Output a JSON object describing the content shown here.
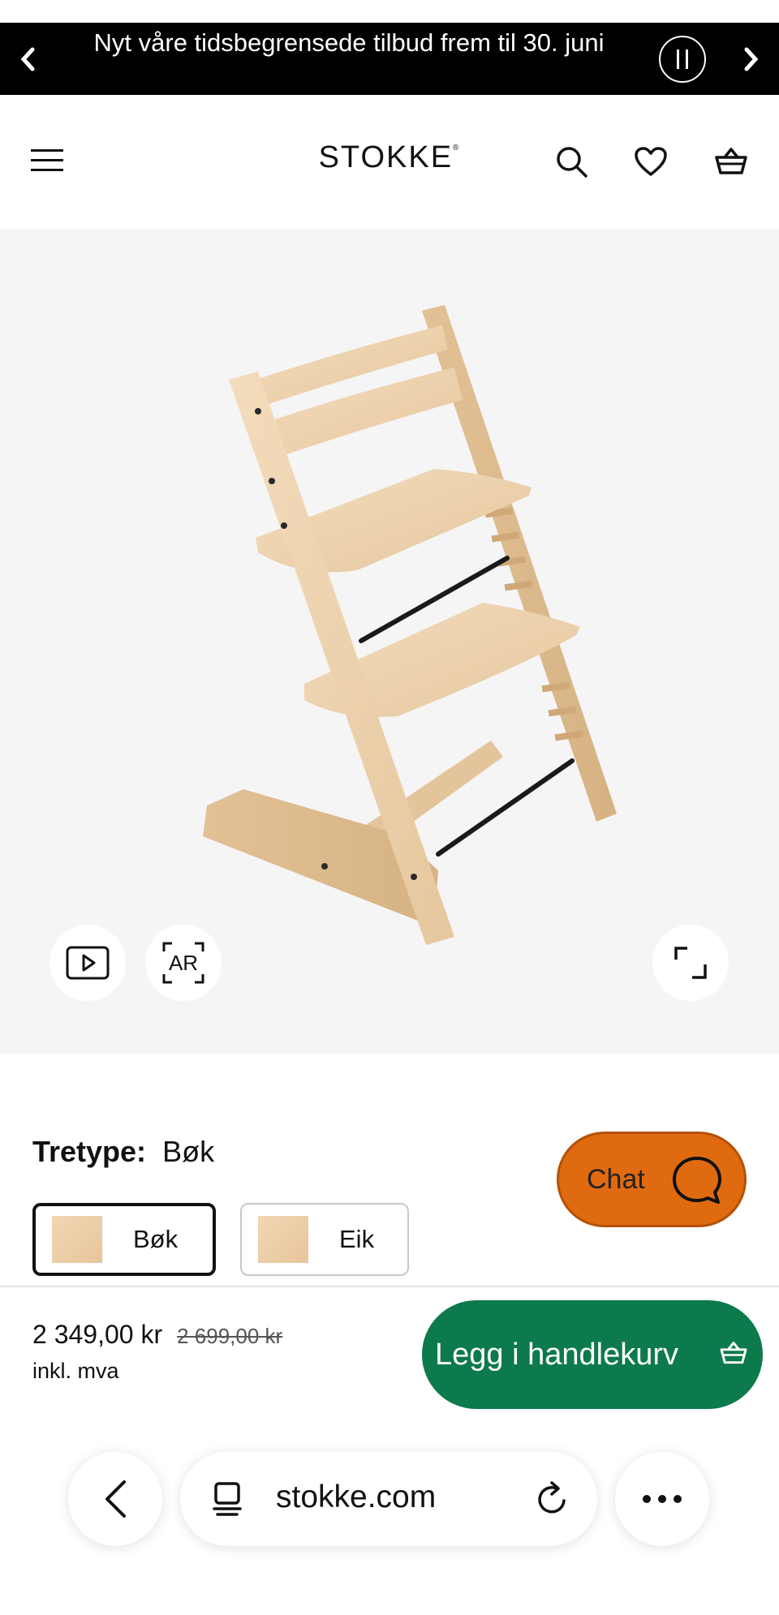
{
  "promo": {
    "prev_icon": "chevron-left-icon",
    "text": "Nyt våre tidsbegrensede tilbud frem til 30. juni",
    "pause_icon": "pause-icon",
    "next_icon": "chevron-right-icon"
  },
  "header": {
    "logo": "STOKKE",
    "logo_mark": "®",
    "icons": [
      "menu-icon",
      "search-icon",
      "heart-icon",
      "basket-icon"
    ]
  },
  "gallery": {
    "video_icon": "play-icon",
    "ar_label": "AR",
    "fullscreen_icon": "expand-icon"
  },
  "options": {
    "label": "Tretype:",
    "selected": "Bøk",
    "swatches": [
      {
        "label": "Bøk",
        "selected": true
      },
      {
        "label": "Eik",
        "selected": false
      }
    ]
  },
  "chat": {
    "label": "Chat",
    "color": "#e06a10"
  },
  "buy": {
    "price": "2 349,00 kr",
    "old_price": "2 699,00 kr",
    "vat": "inkl. mva",
    "button": "Legg i handlekurv",
    "button_color": "#0c7a4b"
  },
  "browser": {
    "url": "stokke.com",
    "icons": [
      "back-icon",
      "tabs-icon",
      "reload-icon",
      "more-icon"
    ]
  }
}
